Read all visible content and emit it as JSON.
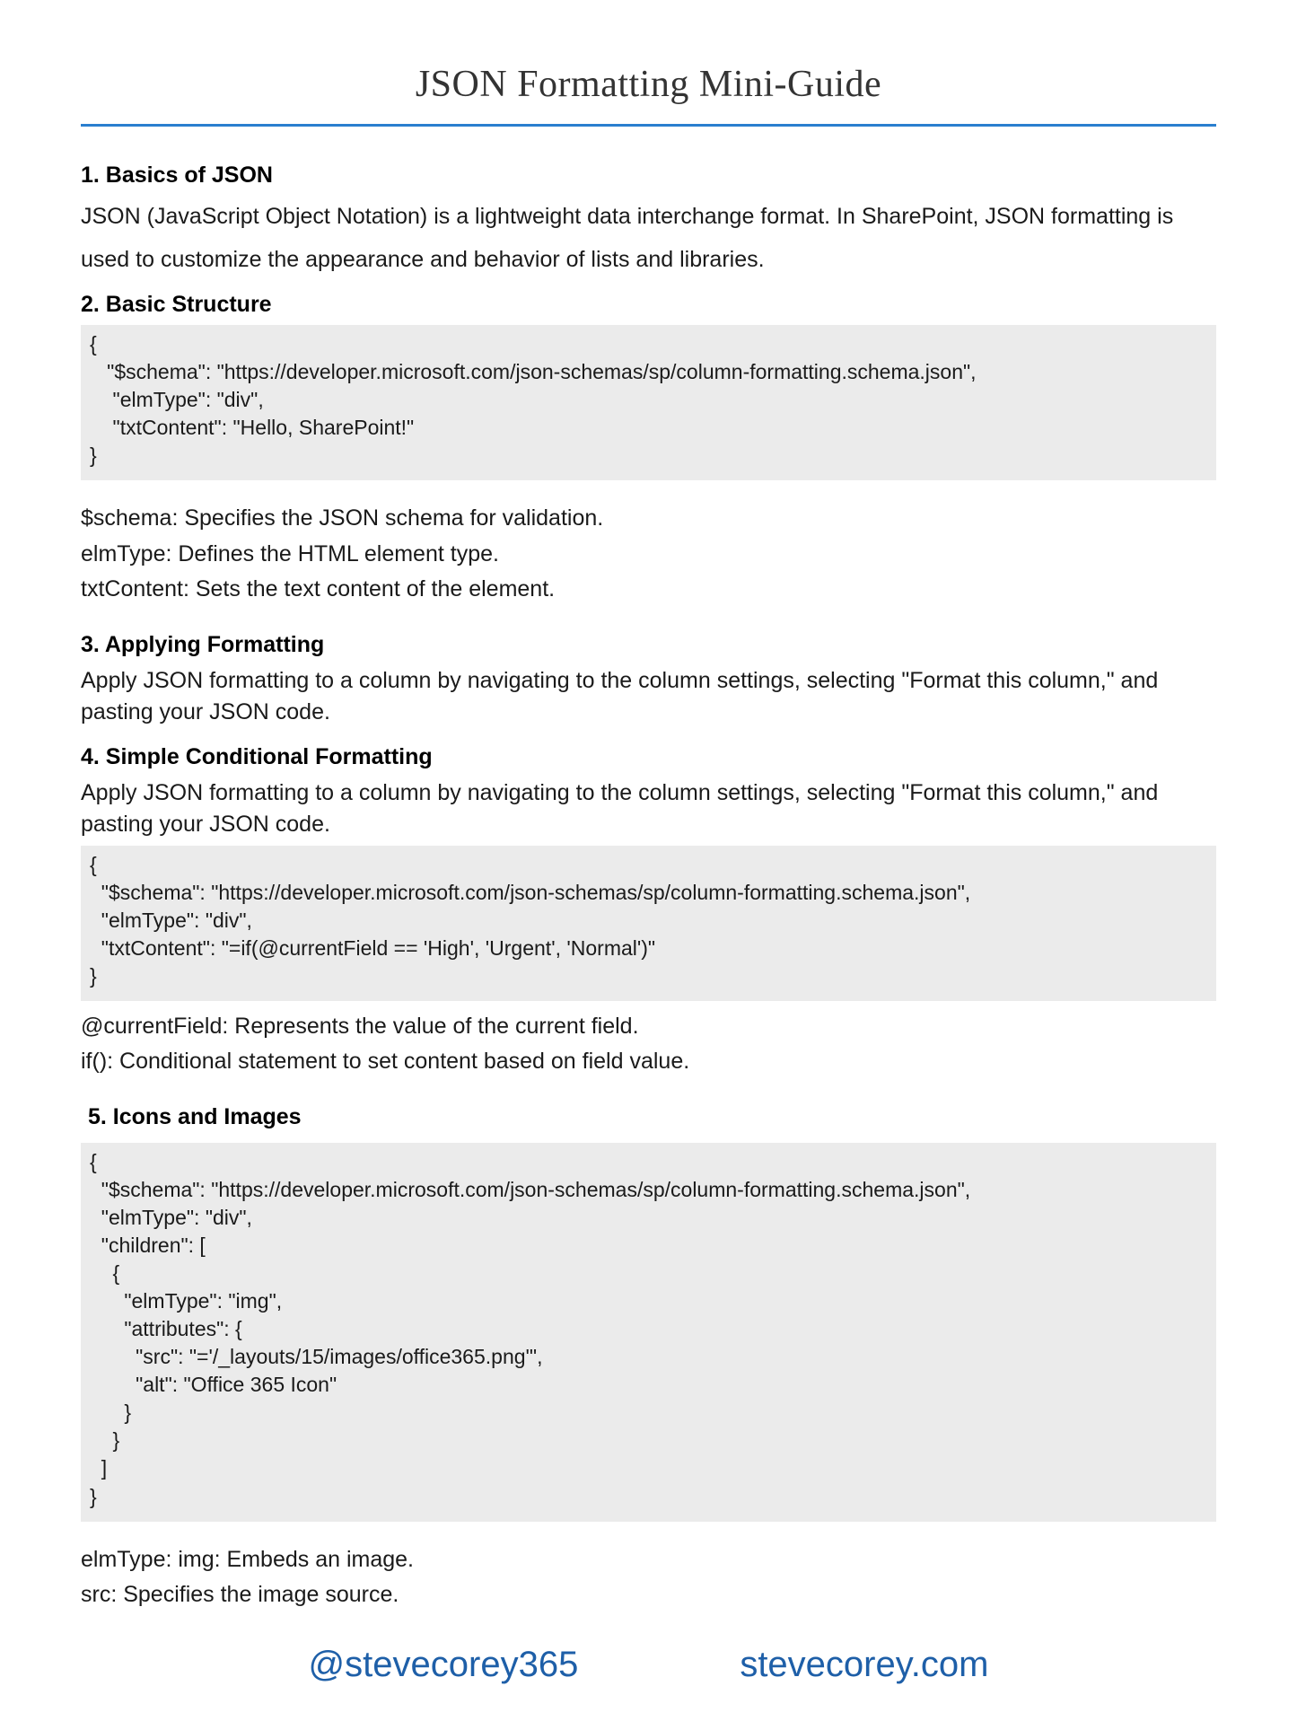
{
  "title": "JSON Formatting Mini-Guide",
  "section1": {
    "heading": "1. Basics of JSON",
    "para": "JSON (JavaScript Object Notation) is a lightweight data interchange format. In SharePoint, JSON formatting is used to customize the appearance and behavior of lists and libraries."
  },
  "section2": {
    "heading": "2. Basic Structure",
    "code": "{\n   \"$schema\": \"https://developer.microsoft.com/json-schemas/sp/column-formatting.schema.json\",\n    \"elmType\": \"div\",\n    \"txtContent\": \"Hello, SharePoint!\"\n}",
    "desc1": "$schema: Specifies the JSON schema for validation.",
    "desc2": "elmType: Defines the HTML element type.",
    "desc3": "txtContent: Sets the text content of the element."
  },
  "section3": {
    "heading": "3. Applying Formatting",
    "para": "Apply JSON formatting to a column by navigating to the column settings, selecting \"Format this column,\" and pasting your JSON code."
  },
  "section4": {
    "heading": "4. Simple Conditional Formatting",
    "para": "Apply JSON formatting to a column by navigating to the column settings, selecting \"Format this column,\" and pasting your JSON code.",
    "code": "{\n  \"$schema\": \"https://developer.microsoft.com/json-schemas/sp/column-formatting.schema.json\",\n  \"elmType\": \"div\",\n  \"txtContent\": \"=if(@currentField == 'High', 'Urgent', 'Normal')\"\n}",
    "desc1": "@currentField: Represents the value of the current field.",
    "desc2": "if(): Conditional statement to set content based on field value."
  },
  "section5": {
    "heading": " 5. Icons and Images",
    "code": "{\n  \"$schema\": \"https://developer.microsoft.com/json-schemas/sp/column-formatting.schema.json\",\n  \"elmType\": \"div\",\n  \"children\": [\n    {\n      \"elmType\": \"img\",\n      \"attributes\": {\n        \"src\": \"='/_layouts/15/images/office365.png'\",\n        \"alt\": \"Office 365 Icon\"\n      }\n    }\n  ]\n}",
    "desc1": "elmType: img: Embeds an image.",
    "desc2": "src: Specifies the image source."
  },
  "footer": {
    "handle": "@stevecorey365",
    "site": "stevecorey.com"
  }
}
